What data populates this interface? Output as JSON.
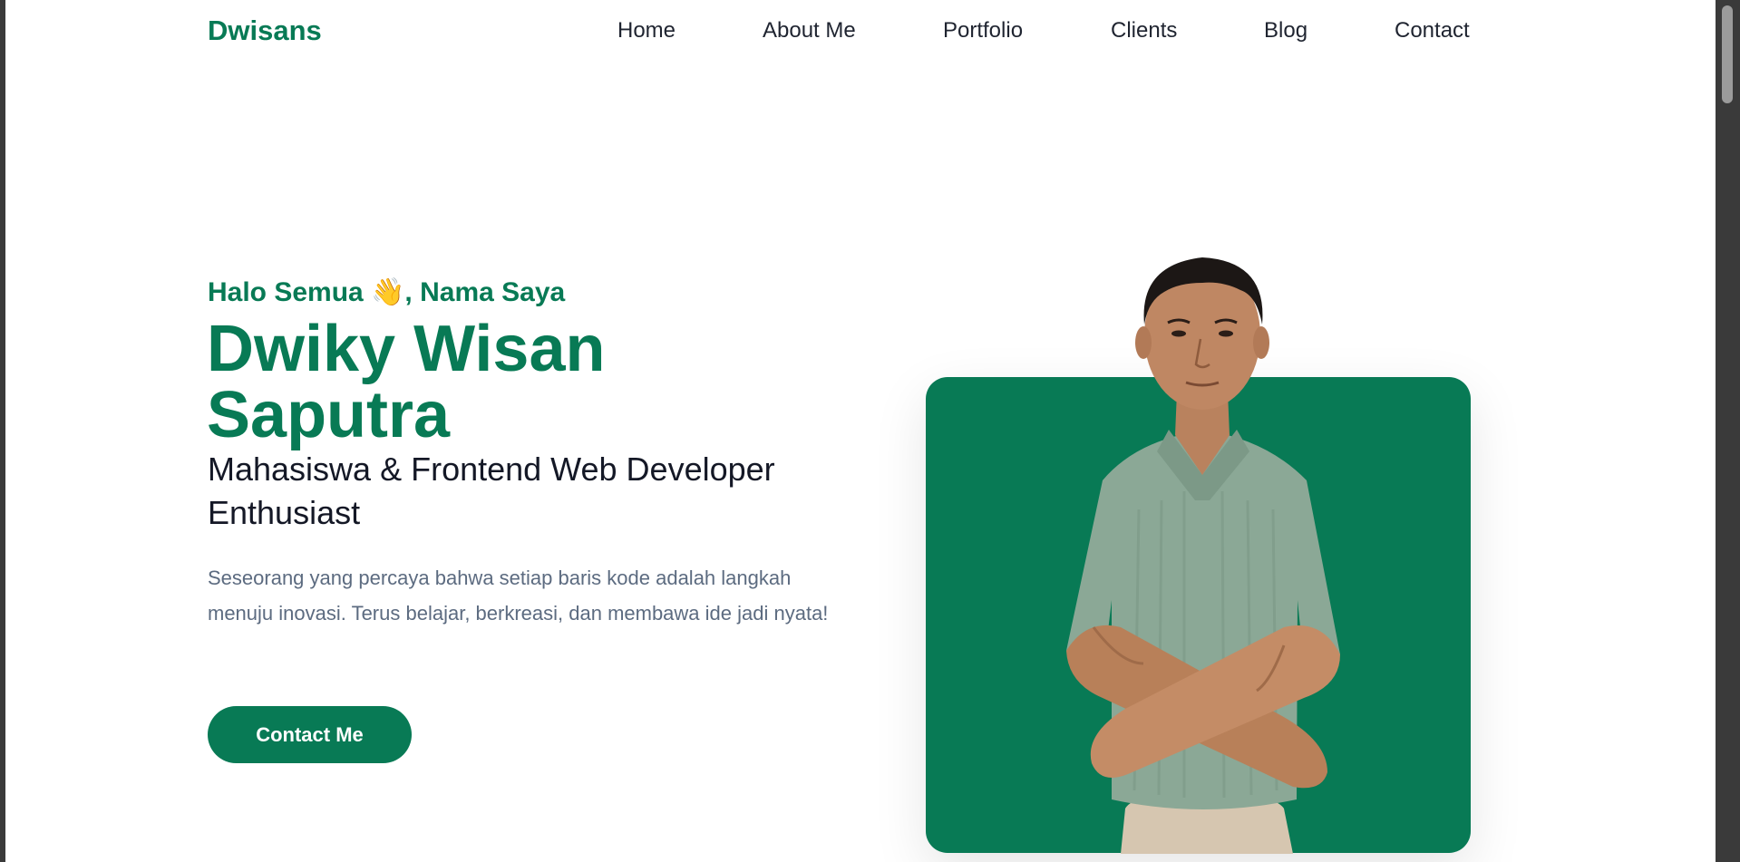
{
  "site": {
    "logo": "Dwisans",
    "brand_color": "#087a55"
  },
  "nav": {
    "items": [
      {
        "label": "Home"
      },
      {
        "label": "About Me"
      },
      {
        "label": "Portfolio"
      },
      {
        "label": "Clients"
      },
      {
        "label": "Blog"
      },
      {
        "label": "Contact"
      }
    ]
  },
  "hero": {
    "greeting_pre": "Halo Semua ",
    "greeting_emoji": "👋",
    "greeting_post": ", Nama Saya",
    "name_line1": "Dwiky Wisan",
    "name_line2": "Saputra",
    "role": "Mahasiswa & Frontend Web Developer Enthusiast",
    "bio": "Seseorang yang percaya bahwa setiap baris kode adalah langkah menuju inovasi. Terus belajar, berkreasi, dan membawa ide jadi nyata!",
    "cta_label": "Contact Me"
  },
  "photo": {
    "icon": "portrait-photo",
    "card_color": "#087a55"
  }
}
